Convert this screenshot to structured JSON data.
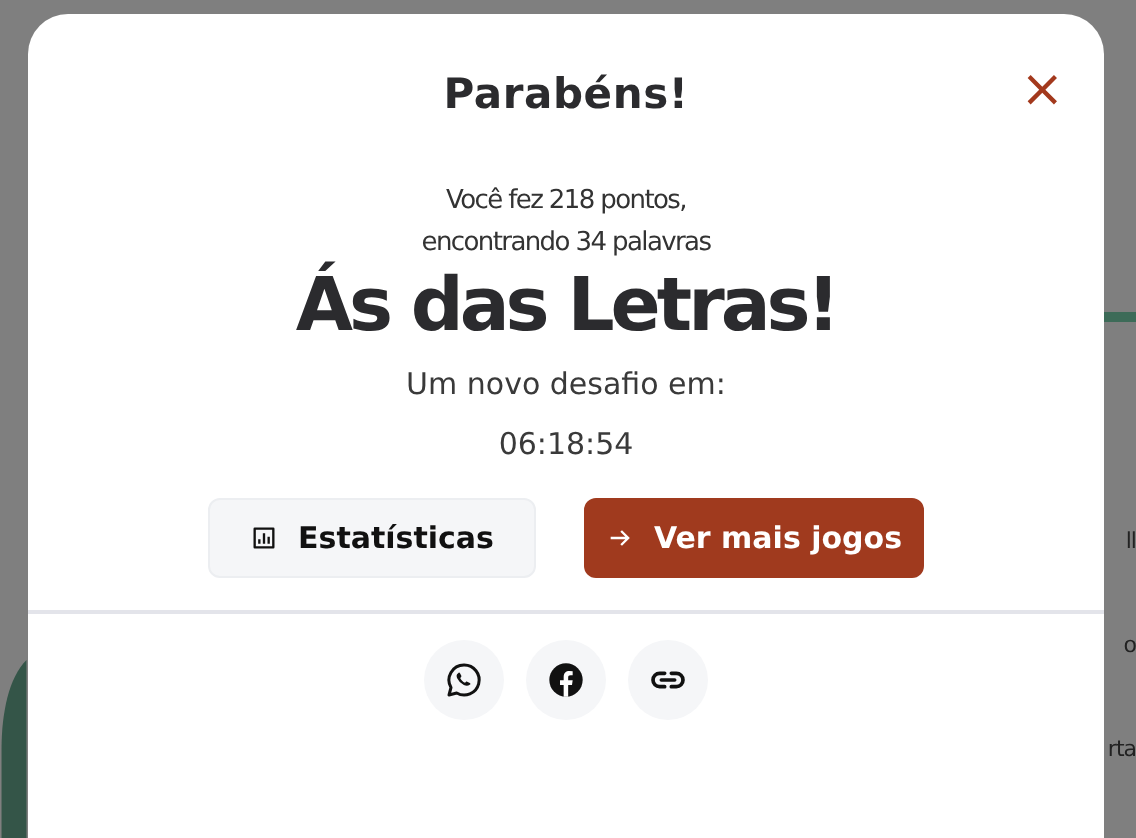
{
  "background_fragments": [
    "ll",
    "o",
    "rta"
  ],
  "dialog": {
    "title": "Parabéns!",
    "close": "×",
    "summary_lines": [
      "Você fez 218 pontos,",
      "encontrando 34 palavras"
    ],
    "rank": "Ás das Letras!",
    "next_label": "Um novo desafio em:",
    "countdown": "06:18:54",
    "buttons": [
      {
        "kind": "stats",
        "label": "Estatísticas"
      },
      {
        "kind": "more",
        "label": "Ver mais jogos"
      }
    ],
    "share": [
      {
        "kind": "whatsapp"
      },
      {
        "kind": "facebook"
      },
      {
        "kind": "link"
      }
    ]
  }
}
